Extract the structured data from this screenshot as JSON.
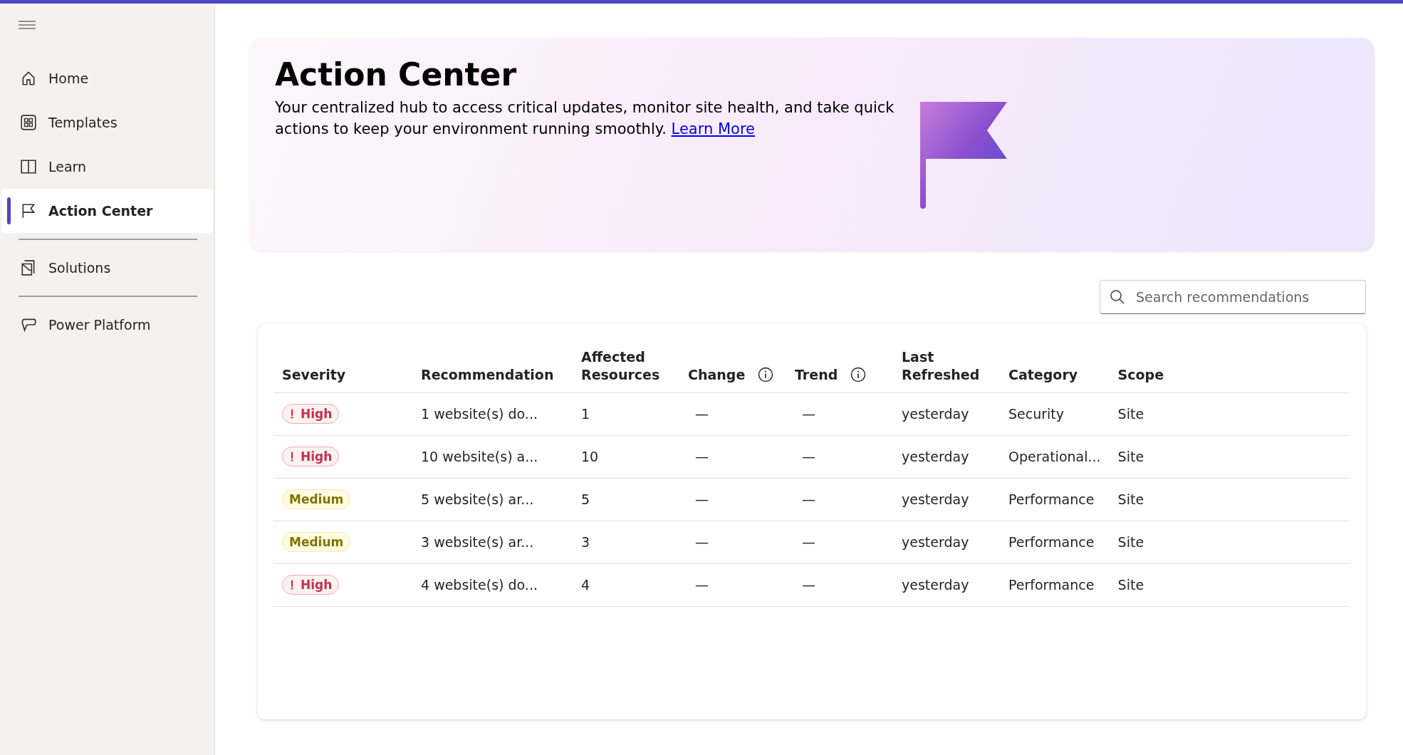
{
  "sidebar": {
    "items": [
      {
        "label": "Home",
        "selected": false
      },
      {
        "label": "Templates",
        "selected": false
      },
      {
        "label": "Learn",
        "selected": false
      },
      {
        "label": "Action Center",
        "selected": true
      },
      {
        "kind": "divider"
      },
      {
        "label": "Solutions",
        "selected": false
      },
      {
        "kind": "divider"
      },
      {
        "label": "Power Platform",
        "selected": false
      }
    ]
  },
  "banner": {
    "title": "Action Center",
    "description": "Your centralized hub to access critical updates, monitor site health, and take quick actions to keep your environment running smoothly.",
    "link": "Learn More"
  },
  "search": {
    "placeholder": "Search recommendations"
  },
  "table": {
    "columns": [
      {
        "label": "Severity"
      },
      {
        "label": "Recommendation"
      },
      {
        "label": "Affected Resources"
      },
      {
        "label": "Change",
        "info": true
      },
      {
        "label": "Trend",
        "info": true
      },
      {
        "label": "Last Refreshed"
      },
      {
        "label": "Category"
      },
      {
        "label": "Scope"
      }
    ],
    "rows": [
      {
        "severity": {
          "label": "High",
          "kind": "high"
        },
        "recommendation": "1 website(s) do...",
        "affected_resources": "1",
        "change": "—",
        "trend": "—",
        "last_refreshed": "yesterday",
        "category": "Security",
        "scope": "Site"
      },
      {
        "severity": {
          "label": "High",
          "kind": "high"
        },
        "recommendation": "10 website(s) a...",
        "affected_resources": "10",
        "change": "—",
        "trend": "—",
        "last_refreshed": "yesterday",
        "category": "Operational...",
        "scope": "Site"
      },
      {
        "severity": {
          "label": "Medium",
          "kind": "medium"
        },
        "recommendation": "5 website(s) ar...",
        "affected_resources": "5",
        "change": "—",
        "trend": "—",
        "last_refreshed": "yesterday",
        "category": "Performance",
        "scope": "Site"
      },
      {
        "severity": {
          "label": "Medium",
          "kind": "medium"
        },
        "recommendation": "3 website(s) ar...",
        "affected_resources": "3",
        "change": "—",
        "trend": "—",
        "last_refreshed": "yesterday",
        "category": "Performance",
        "scope": "Site"
      },
      {
        "severity": {
          "label": "High",
          "kind": "high"
        },
        "recommendation": "4 website(s) do...",
        "affected_resources": "4",
        "change": "—",
        "trend": "—",
        "last_refreshed": "yesterday",
        "category": "Performance",
        "scope": "Site"
      }
    ]
  }
}
